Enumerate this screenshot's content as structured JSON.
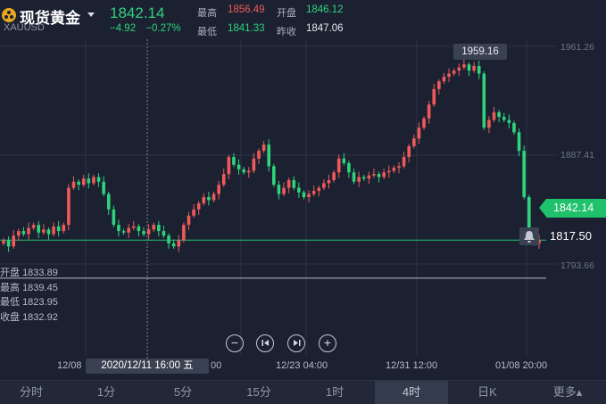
{
  "header": {
    "title": "现货黄金",
    "symbol": "XAUUSD",
    "last_price": "1842.14",
    "change": "−4.92",
    "change_pct": "−0.27%",
    "high_label": "最高",
    "high": "1856.49",
    "open_label": "开盘",
    "open": "1846.12",
    "low_label": "最低",
    "low": "1841.33",
    "prev_close_label": "昨收",
    "prev_close": "1847.06"
  },
  "chart": {
    "y_labels": [
      "1961.26",
      "1887.41",
      "1793.66"
    ],
    "high_marker": "1959.16",
    "current_price_tag": "1842.14",
    "alert_price": "1817.50",
    "x_labels": [
      "12/08",
      "00",
      "12/23 04:00",
      "12/31 12:00",
      "01/08 20:00"
    ],
    "cursor_date": "2020/12/11 16:00 五",
    "ohlc": {
      "open_label": "开盘",
      "open": "1833.89",
      "high_label": "最高",
      "high": "1839.45",
      "low_label": "最低",
      "low": "1823.95",
      "close_label": "收盘",
      "close": "1832.92"
    },
    "controls": [
      "zoom-out",
      "previous",
      "next",
      "zoom-in"
    ]
  },
  "chart_data": {
    "type": "candlestick",
    "y_range": [
      1770,
      1970
    ],
    "candles_close": [
      1842,
      1838,
      1845,
      1848,
      1846,
      1850,
      1852,
      1847,
      1849,
      1846,
      1851,
      1848,
      1852,
      1876,
      1880,
      1878,
      1882,
      1879,
      1883,
      1880,
      1872,
      1862,
      1852,
      1848,
      1847,
      1850,
      1851,
      1848,
      1846,
      1849,
      1852,
      1848,
      1845,
      1840,
      1838,
      1842,
      1852,
      1858,
      1862,
      1866,
      1870,
      1868,
      1872,
      1878,
      1885,
      1896,
      1891,
      1888,
      1886,
      1887,
      1895,
      1900,
      1904,
      1890,
      1878,
      1872,
      1876,
      1881,
      1876,
      1873,
      1870,
      1872,
      1874,
      1876,
      1879,
      1881,
      1886,
      1895,
      1892,
      1886,
      1880,
      1883,
      1882,
      1884,
      1885,
      1883,
      1886,
      1887,
      1889,
      1890,
      1896,
      1903,
      1908,
      1915,
      1921,
      1930,
      1940,
      1945,
      1948,
      1950,
      1952,
      1954,
      1956,
      1952,
      1955,
      1950,
      1915,
      1920,
      1925,
      1922,
      1920,
      1918,
      1912,
      1900,
      1870,
      1845,
      1840,
      1842
    ],
    "colors": {
      "up": "#ee5a5a",
      "down": "#2fd37b"
    }
  },
  "tabs": {
    "items": [
      "分时",
      "1分",
      "5分",
      "15分",
      "1时",
      "4时",
      "日K",
      "更多▴"
    ],
    "active": "4时"
  }
}
